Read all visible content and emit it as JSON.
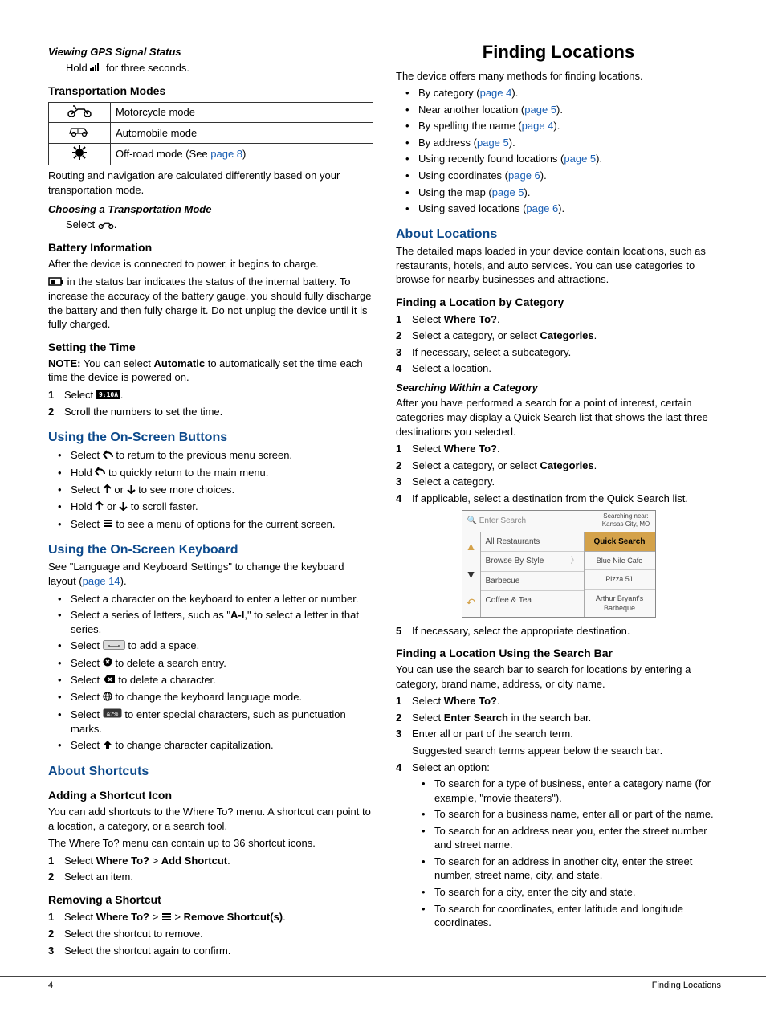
{
  "footer": {
    "page": "4",
    "section": "Finding Locations"
  },
  "left": {
    "gps_h": "Viewing GPS Signal Status",
    "gps_p_a": "Hold ",
    "gps_p_b": " for three seconds.",
    "tm_h": "Transportation Modes",
    "tm_rows": [
      {
        "label": "Motorcycle mode"
      },
      {
        "label": "Automobile mode"
      },
      {
        "label_a": "Off-road mode (See ",
        "link": "page 8",
        "label_b": ")"
      }
    ],
    "tm_note": "Routing and navigation are calculated differently based on your transportation mode.",
    "ctm_h": "Choosing a Transportation Mode",
    "ctm_p_a": "Select ",
    "ctm_p_b": ".",
    "bat_h": "Battery Information",
    "bat_p1": "After the device is connected to power, it begins to charge.",
    "bat_p2": " in the status bar indicates the status of the internal battery. To increase the accuracy of the battery gauge, you should fully discharge the battery and then fully charge it. Do not unplug the device until it is fully charged.",
    "time_h": "Setting the Time",
    "time_note_a": "NOTE:",
    "time_note_b": " You can select ",
    "time_note_c": "Automatic",
    "time_note_d": " to automatically set the time each time the device is powered on.",
    "time_s1_a": "Select ",
    "time_s1_b": ".",
    "time_s2": "Scroll the numbers to set the time.",
    "osb_h": "Using the On-Screen Buttons",
    "osb": [
      {
        "a": "Select ",
        "b": " to return to the previous menu screen."
      },
      {
        "a": "Hold ",
        "b": " to quickly return to the main menu."
      },
      {
        "a": "Select ",
        "b": " or ",
        "c": " to see more choices."
      },
      {
        "a": "Hold ",
        "b": " or ",
        "c": " to scroll faster."
      },
      {
        "a": "Select ",
        "b": " to see a menu of options for the current screen."
      }
    ],
    "osk_h": "Using the On-Screen Keyboard",
    "osk_intro_a": "See \"Language and Keyboard Settings\" to change the keyboard layout (",
    "osk_intro_link": "page 14",
    "osk_intro_b": ").",
    "osk": [
      "Select a character on the keyboard to enter a letter or number.",
      "Select a series of letters, such as \"A-I,\" to select a letter in that series.",
      {
        "a": "Select ",
        "b": " to add a space."
      },
      {
        "a": "Select ",
        "b": " to delete a search entry."
      },
      {
        "a": "Select ",
        "b": " to delete a character."
      },
      {
        "a": "Select ",
        "b": " to change the keyboard language mode."
      },
      {
        "a": "Select ",
        "b": " to enter special characters, such as punctuation marks."
      },
      {
        "a": "Select ",
        "b": " to change character capitalization."
      }
    ],
    "sc_h": "About Shortcuts",
    "asc_h": "Adding a Shortcut Icon",
    "asc_p1": "You can add shortcuts to the Where To? menu. A shortcut can point to a location, a category, or a search tool.",
    "asc_p2": "The Where To? menu can contain up to 36 shortcut icons.",
    "asc_s1_a": "Select ",
    "asc_s1_b": "Where To?",
    "asc_s1_c": " > ",
    "asc_s1_d": "Add Shortcut",
    "asc_s1_e": ".",
    "asc_s2": "Select an item.",
    "rsc_h": "Removing a Shortcut",
    "rsc_s1_a": "Select ",
    "rsc_s1_b": "Where To?",
    "rsc_s1_c": " > ",
    "rsc_s1_d": " > ",
    "rsc_s1_e": "Remove Shortcut(s)",
    "rsc_s1_f": ".",
    "rsc_s2": "Select the shortcut to remove.",
    "rsc_s3": "Select the shortcut again to confirm."
  },
  "right": {
    "fl_h": "Finding Locations",
    "fl_intro": "The device offers many methods for finding locations.",
    "fl_list": [
      {
        "a": "By category (",
        "link": "page 4",
        "b": ")."
      },
      {
        "a": "Near another location (",
        "link": "page 5",
        "b": ")."
      },
      {
        "a": "By spelling the name (",
        "link": "page 4",
        "b": ")."
      },
      {
        "a": "By address (",
        "link": "page 5",
        "b": ")."
      },
      {
        "a": "Using recently found locations (",
        "link": "page 5",
        "b": ")."
      },
      {
        "a": "Using coordinates (",
        "link": "page 6",
        "b": ")."
      },
      {
        "a": "Using the map (",
        "link": "page 5",
        "b": ")."
      },
      {
        "a": "Using saved locations (",
        "link": "page 6",
        "b": ")."
      }
    ],
    "al_h": "About Locations",
    "al_p": "The detailed maps loaded in your device contain locations, such as restaurants, hotels, and auto services. You can use categories to browse for nearby businesses and attractions.",
    "flc_h": "Finding a Location by Category",
    "flc_s1_a": "Select ",
    "flc_s1_b": "Where To?",
    "flc_s1_c": ".",
    "flc_s2_a": "Select a category, or select ",
    "flc_s2_b": "Categories",
    "flc_s2_c": ".",
    "flc_s3": "If necessary, select a subcategory.",
    "flc_s4": "Select a location.",
    "swc_h": "Searching Within a Category",
    "swc_p": "After you have performed a search for a point of interest, certain categories may display a Quick Search list that shows the last three destinations you selected.",
    "swc_s1_a": "Select ",
    "swc_s1_b": "Where To?",
    "swc_s1_c": ".",
    "swc_s2_a": "Select a category, or select ",
    "swc_s2_b": "Categories",
    "swc_s2_c": ".",
    "swc_s3": "Select a category.",
    "swc_s4": "If applicable, select a destination from the Quick Search list.",
    "swc_s5": "If necessary, select the appropriate destination.",
    "ui": {
      "search_ph": "Enter Search",
      "near_a": "Searching near:",
      "near_b": "Kansas City, MO",
      "cats": [
        "All Restaurants",
        "Browse By Style",
        "Barbecue",
        "Coffee & Tea"
      ],
      "qs_h": "Quick Search",
      "qs": [
        "Blue Nile Cafe",
        "Pizza 51",
        "Arthur Bryant's Barbeque"
      ]
    },
    "flsb_h": "Finding a Location Using the Search Bar",
    "flsb_p": "You can use the search bar to search for locations by entering a category, brand name, address, or city name.",
    "flsb_s1_a": "Select ",
    "flsb_s1_b": "Where To?",
    "flsb_s1_c": ".",
    "flsb_s2_a": "Select ",
    "flsb_s2_b": "Enter Search",
    "flsb_s2_c": " in the search bar.",
    "flsb_s3": "Enter all or part of the search term.",
    "flsb_s3_sub": "Suggested search terms appear below the search bar.",
    "flsb_s4": "Select an option:",
    "flsb_opts": [
      "To search for a type of business, enter a category name (for example, \"movie theaters\").",
      "To search for a business name, enter all or part of the name.",
      "To search for an address near you, enter the street number and street name.",
      "To search for an address in another city, enter the street number, street name, city, and state.",
      "To search for a city, enter the city and state.",
      "To search for coordinates, enter latitude and longitude coordinates."
    ]
  }
}
